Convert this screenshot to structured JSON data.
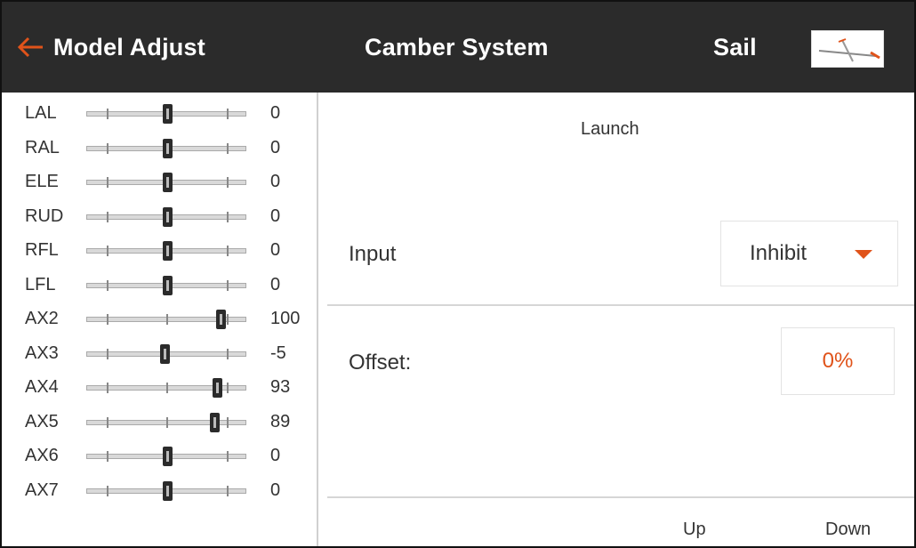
{
  "header": {
    "back_label": "Model Adjust",
    "title": "Camber System",
    "model_name": "Sail",
    "accent_color": "#e0531a"
  },
  "channels": [
    {
      "name": "LAL",
      "value": "0",
      "level": 0
    },
    {
      "name": "RAL",
      "value": "0",
      "level": 0
    },
    {
      "name": "ELE",
      "value": "0",
      "level": 0
    },
    {
      "name": "RUD",
      "value": "0",
      "level": 0
    },
    {
      "name": "RFL",
      "value": "0",
      "level": 0
    },
    {
      "name": "LFL",
      "value": "0",
      "level": 0
    },
    {
      "name": "AX2",
      "value": "100",
      "level": 100
    },
    {
      "name": "AX3",
      "value": "-5",
      "level": -5
    },
    {
      "name": "AX4",
      "value": "93",
      "level": 93
    },
    {
      "name": "AX5",
      "value": "89",
      "level": 89
    },
    {
      "name": "AX6",
      "value": "0",
      "level": 0
    },
    {
      "name": "AX7",
      "value": "0",
      "level": 0
    }
  ],
  "main": {
    "flight_mode": "Launch",
    "input_label": "Input",
    "input_value": "Inhibit",
    "offset_label": "Offset:",
    "offset_value": "0%",
    "columns": [
      "Up",
      "Down"
    ]
  }
}
